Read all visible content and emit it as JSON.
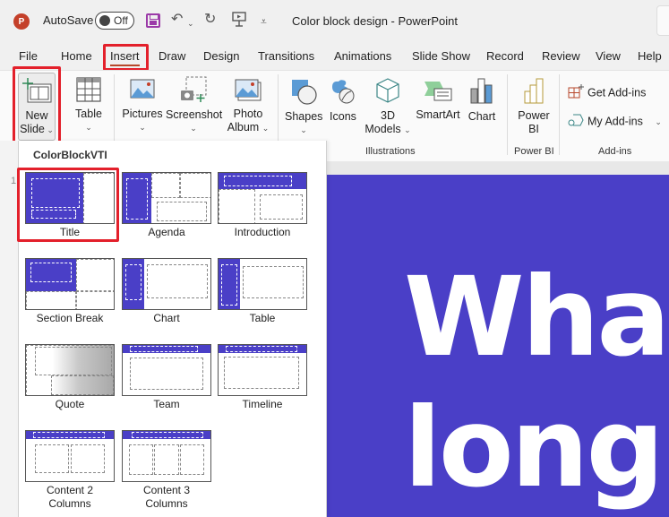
{
  "titlebar": {
    "app_icon": "P",
    "autosave_label": "AutoSave",
    "autosave_state": "Off",
    "qat_icons": [
      "save-icon",
      "undo-icon",
      "undo-dropdown-icon",
      "redo-icon",
      "present-icon",
      "customize-qat-icon"
    ],
    "document_title": "Color block design  -  PowerPoint"
  },
  "tabs": [
    {
      "label": "File"
    },
    {
      "label": "Home"
    },
    {
      "label": "Insert",
      "active": true
    },
    {
      "label": "Draw"
    },
    {
      "label": "Design"
    },
    {
      "label": "Transitions"
    },
    {
      "label": "Animations"
    },
    {
      "label": "Slide Show"
    },
    {
      "label": "Record"
    },
    {
      "label": "Review"
    },
    {
      "label": "View"
    },
    {
      "label": "Help"
    }
  ],
  "ribbon": {
    "new_slide": {
      "line1": "New",
      "line2": "Slide"
    },
    "table": {
      "label": "Table"
    },
    "pictures": {
      "label": "Pictures"
    },
    "screenshot": {
      "label": "Screenshot"
    },
    "photo_album": {
      "line1": "Photo",
      "line2": "Album"
    },
    "shapes": {
      "label": "Shapes"
    },
    "icons": {
      "label": "Icons"
    },
    "models_3d": {
      "line1": "3D",
      "line2": "Models"
    },
    "smartart": {
      "label": "SmartArt"
    },
    "chart": {
      "label": "Chart"
    },
    "power_bi": {
      "line1": "Power",
      "line2": "BI"
    },
    "get_addins": {
      "label": "Get Add-ins"
    },
    "my_addins": {
      "label": "My Add-ins"
    },
    "groups": {
      "illustrations": "Illustrations",
      "power_bi": "Power BI",
      "addins": "Add-ins"
    }
  },
  "gallery": {
    "title": "ColorBlockVTI",
    "layouts": [
      {
        "label": "Title",
        "selected": true
      },
      {
        "label": "Agenda"
      },
      {
        "label": "Introduction"
      },
      {
        "label": "Section Break"
      },
      {
        "label": "Chart"
      },
      {
        "label": "Table"
      },
      {
        "label": "Quote"
      },
      {
        "label": "Team"
      },
      {
        "label": "Timeline"
      },
      {
        "label": "Content 2 Columns"
      },
      {
        "label": "Content 3 Columns"
      }
    ]
  },
  "slide_panel": {
    "slide_number": "1"
  },
  "slide": {
    "line1": "What",
    "line2": "long",
    "background": "#4a3fc7"
  },
  "colors": {
    "accent": "#4a3fc7",
    "highlight": "#e3202b",
    "ppt_brand": "#c4402a"
  }
}
